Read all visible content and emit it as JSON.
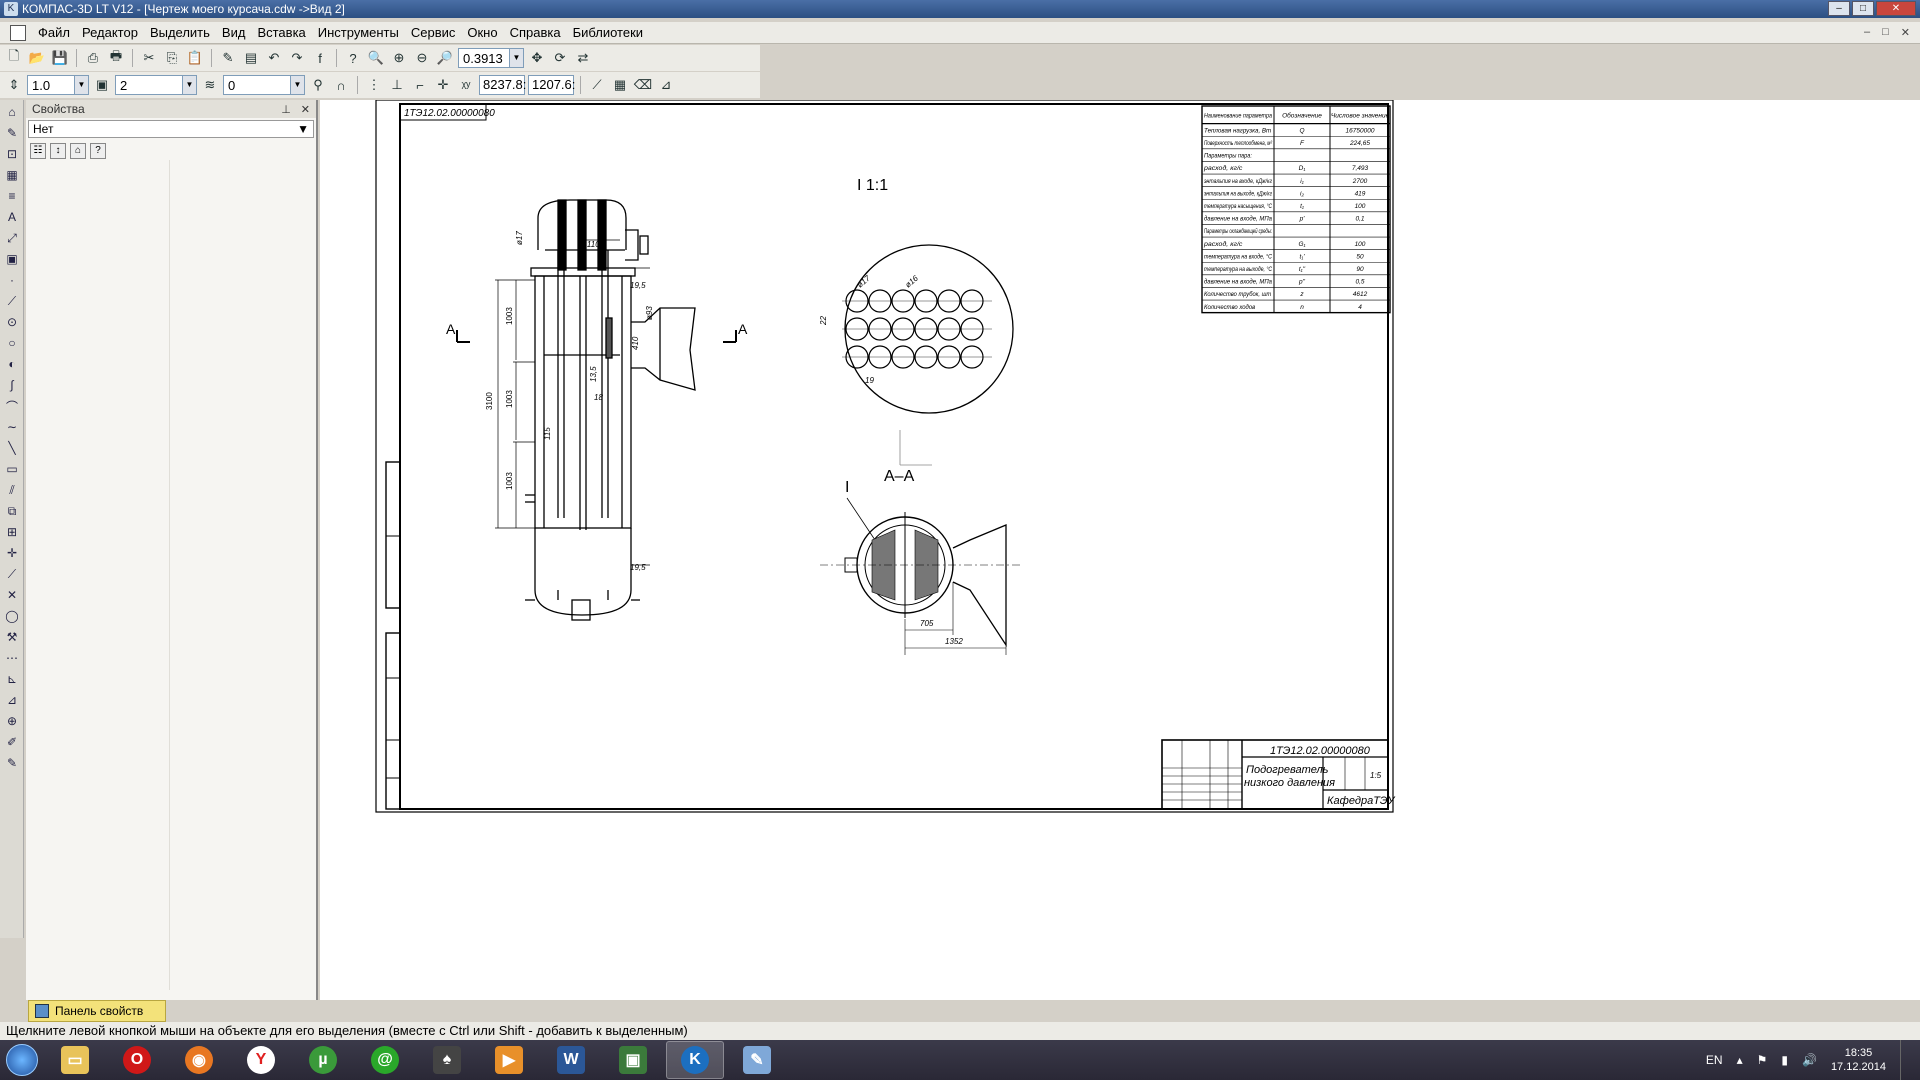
{
  "window": {
    "title": "КОМПАС-3D LT V12 - [Чертеж моего курсача.cdw ->Вид 2]"
  },
  "menu": [
    "Файл",
    "Редактор",
    "Выделить",
    "Вид",
    "Вставка",
    "Инструменты",
    "Сервис",
    "Окно",
    "Справка",
    "Библиотеки"
  ],
  "toolbar": {
    "zoom_value": "0.3913"
  },
  "toolbar2": {
    "scale_value": "1.0",
    "step_value": "2",
    "layer_value": "0",
    "coord_x": "8237.8:",
    "coord_y": "1207.6:"
  },
  "properties": {
    "title": "Свойства",
    "selector": "Нет"
  },
  "panel_tab": {
    "label": "Панель свойств"
  },
  "status": {
    "hint": "Щелкните левой кнопкой мыши на объекте для его выделения (вместе с Ctrl или Shift - добавить к выделенным)"
  },
  "drawing": {
    "stamp_top": "1ТЭ12.02.00000080",
    "detail_label": "I 1:1",
    "section_label": "А–А",
    "section_mark_left": "А",
    "section_mark_right": "А",
    "detail_mark": "I",
    "dims": {
      "d1100": "ø1100",
      "d95a": "19,5",
      "d95b": "19,5",
      "d3100": "3100",
      "d1003a": "1003",
      "d1003b": "1003",
      "d1003c": "1003",
      "d705": "705",
      "d1352": "1352",
      "d22": "22",
      "d19": "19",
      "d17a": "ø17",
      "d17b": "ø16",
      "d18": "18",
      "d135": "13,5",
      "d115": "115",
      "d93": "ø93",
      "d410": "410"
    },
    "spec_table": {
      "headers": [
        "Наименование параметра",
        "Обозначение",
        "Числовое значение"
      ],
      "rows": [
        [
          "Тепловая нагрузка, Вт",
          "Q",
          "16750000"
        ],
        [
          "Поверхность теплообмена, м²",
          "F",
          "224,65"
        ],
        [
          "Параметры пара:",
          "",
          ""
        ],
        [
          "расход, кг/с",
          "D₁",
          "7,493"
        ],
        [
          "энтальпия на входе, кДж/кг",
          "i₁",
          "2700"
        ],
        [
          "энтальпия на выходе, кДж/кг",
          "i₂",
          "419"
        ],
        [
          "температура насыщения, °С",
          "t₁",
          "100"
        ],
        [
          "давление на входе, МПа",
          "p'",
          "0,1"
        ],
        [
          "Параметры охлаждающей среды:",
          "",
          ""
        ],
        [
          "расход, кг/с",
          "G₁",
          "100"
        ],
        [
          "температура на входе, °С",
          "t₁'",
          "50"
        ],
        [
          "температура на выходе, °С",
          "t₁''",
          "90"
        ],
        [
          "давление на входе, МПа",
          "p''",
          "0,5"
        ],
        [
          "Количество трубок, шт",
          "z",
          "4612"
        ],
        [
          "Количество ходов",
          "n",
          "4"
        ]
      ]
    },
    "title_block": {
      "code": "1ТЭ12.02.00000080",
      "name_line1": "Подогреватель",
      "name_line2": "низкого давления",
      "sheet_scale": "1:5",
      "org": "КафедраТЭУ"
    }
  },
  "taskbar": {
    "apps": [
      "explorer",
      "opera",
      "firefox",
      "yandex",
      "utorrent",
      "mail-agent",
      "app-ninja",
      "media-player",
      "word",
      "kompas-folder",
      "kompas",
      "paint"
    ],
    "lang": "EN",
    "time": "18:35",
    "date": "17.12.2014"
  },
  "colors": {
    "taskbar": "#2a2836",
    "drawing_line": "#000000",
    "panel_tab": "#f3e27a"
  }
}
